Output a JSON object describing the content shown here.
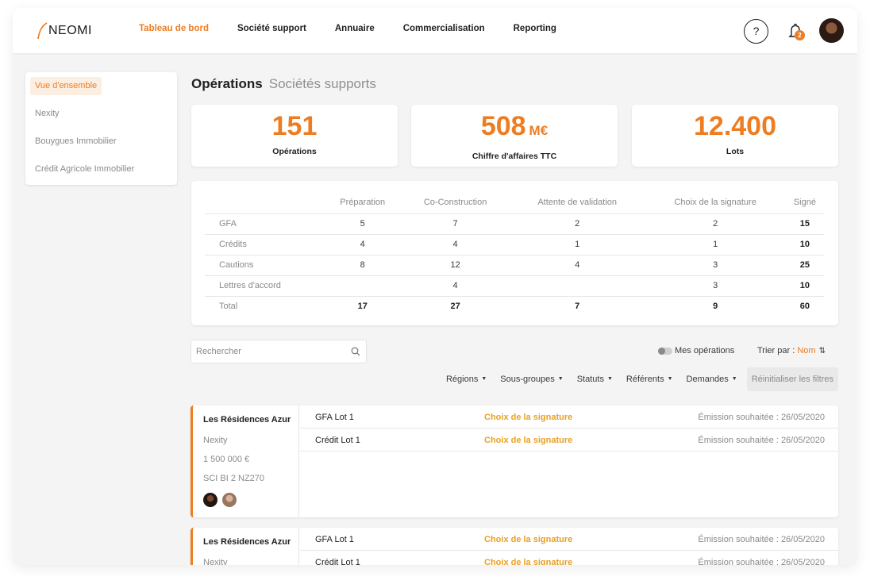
{
  "brand": {
    "name": "NEOMI",
    "accent": "#ee7d22"
  },
  "nav": {
    "items": [
      {
        "label": "Tableau de bord",
        "active": true
      },
      {
        "label": "Société support"
      },
      {
        "label": "Annuaire"
      },
      {
        "label": "Commercialisation"
      },
      {
        "label": "Reporting"
      }
    ],
    "help_label": "?",
    "notifications_count": "2"
  },
  "sidebar": {
    "items": [
      {
        "label": "Vue d'ensemble",
        "active": true
      },
      {
        "label": "Nexity"
      },
      {
        "label": "Bouygues Immobilier"
      },
      {
        "label": "Crédit Agricole Immobilier"
      }
    ]
  },
  "heading": {
    "tab_active": "Opérations",
    "tab_inactive": "Sociétés supports"
  },
  "stats": [
    {
      "value": "151",
      "unit": "",
      "label": "Opérations"
    },
    {
      "value": "508",
      "unit": "M€",
      "label": "Chiffre d'affaires TTC"
    },
    {
      "value": "12.400",
      "unit": "",
      "label": "Lots"
    }
  ],
  "table": {
    "columns": [
      "Préparation",
      "Co-Construction",
      "Attente de validation",
      "Choix de la signature",
      "Signé"
    ],
    "rows": [
      {
        "label": "GFA",
        "cells": [
          "5",
          "7",
          "2",
          "2",
          "15"
        ]
      },
      {
        "label": "Crédits",
        "cells": [
          "4",
          "4",
          "1",
          "1",
          "10"
        ]
      },
      {
        "label": "Cautions",
        "cells": [
          "8",
          "12",
          "4",
          "3",
          "25"
        ]
      },
      {
        "label": "Lettres d'accord",
        "cells": [
          "",
          "4",
          "",
          "3",
          "10"
        ]
      },
      {
        "label": "Total",
        "cells": [
          "17",
          "27",
          "7",
          "9",
          "60"
        ]
      }
    ]
  },
  "search": {
    "placeholder": "Rechercher"
  },
  "toolbar": {
    "my_ops_label": "Mes opérations",
    "sort_label": "Trier par : ",
    "sort_value": "Nom",
    "sort_icon": "⇅"
  },
  "filters": {
    "items": [
      "Régions",
      "Sous-groupes",
      "Statuts",
      "Référents",
      "Demandes"
    ],
    "reset_label": "Réinitialiser les filtres"
  },
  "operations": [
    {
      "name": "Les Résidences Azur",
      "company": "Nexity",
      "amount": "1 500 000 €",
      "sci": "SCI BI 2 NZ270",
      "lots": [
        {
          "lot": "GFA Lot 1",
          "status": "Choix de la signature",
          "date": "Émission souhaitée : 26/05/2020"
        },
        {
          "lot": "Crédit Lot 1",
          "status": "Choix de la signature",
          "date": "Émission souhaitée : 26/05/2020"
        }
      ]
    },
    {
      "name": "Les Résidences Azur",
      "company": "Nexity",
      "lots": [
        {
          "lot": "GFA Lot 1",
          "status": "Choix de la signature",
          "date": "Émission souhaitée : 26/05/2020"
        },
        {
          "lot": "Crédit Lot 1",
          "status": "Choix de la signature",
          "date": "Émission souhaitée : 26/05/2020"
        }
      ]
    }
  ]
}
